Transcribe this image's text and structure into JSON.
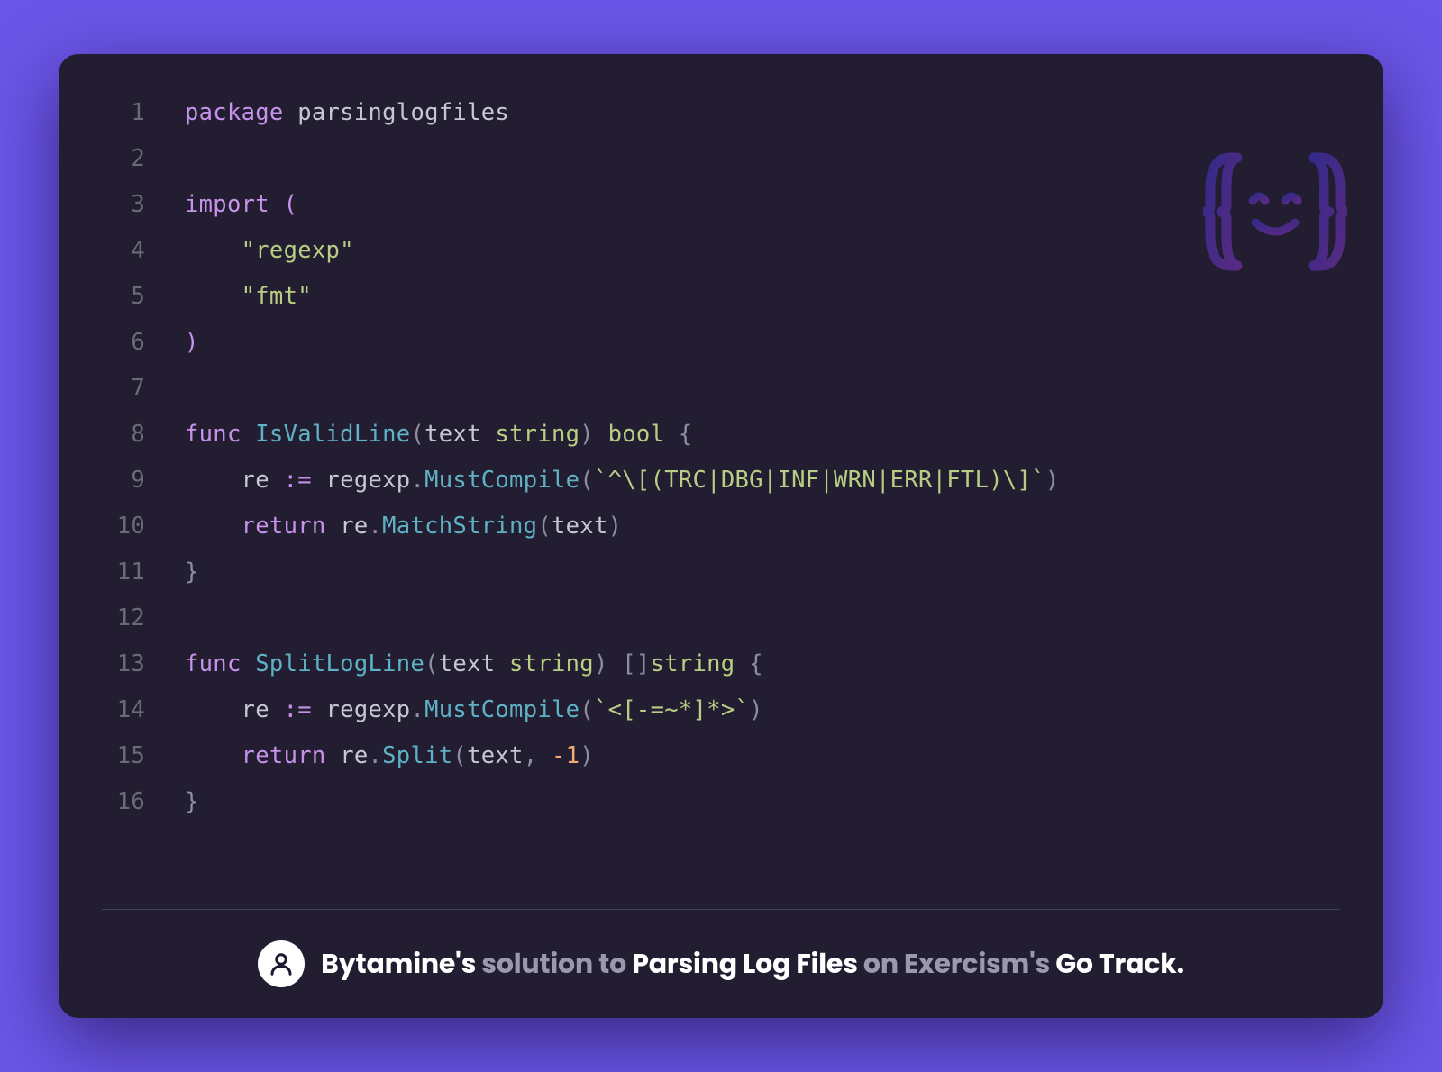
{
  "lineNumbers": [
    "1",
    "2",
    "3",
    "4",
    "5",
    "6",
    "7",
    "8",
    "9",
    "10",
    "11",
    "12",
    "13",
    "14",
    "15",
    "16"
  ],
  "code": {
    "l1": {
      "kw": "package",
      "pkg": " parsinglogfiles"
    },
    "l3": {
      "kw": "import",
      "sp": " ",
      "p": "("
    },
    "l4": {
      "indent": "    ",
      "str": "\"regexp\""
    },
    "l5": {
      "indent": "    ",
      "str": "\"fmt\""
    },
    "l6": {
      "p": ")"
    },
    "l8": {
      "kw": "func",
      "sp": " ",
      "fn": "IsValidLine",
      "po": "(",
      "arg": "text ",
      "typ": "string",
      "pc": ") ",
      "ret": "bool",
      "sp2": " ",
      "brace": "{"
    },
    "l9": {
      "indent": "    ",
      "var": "re ",
      "op": ":= ",
      "obj": "regexp",
      "dot": ".",
      "m": "MustCompile",
      "po": "(",
      "str": "`^\\[(TRC|DBG|INF|WRN|ERR|FTL)\\]`",
      "pc": ")"
    },
    "l10": {
      "indent": "    ",
      "kw": "return",
      "sp": " ",
      "obj": "re",
      "dot": ".",
      "m": "MatchString",
      "po": "(",
      "arg": "text",
      "pc": ")"
    },
    "l11": {
      "brace": "}"
    },
    "l13": {
      "kw": "func",
      "sp": " ",
      "fn": "SplitLogLine",
      "po": "(",
      "arg": "text ",
      "typ": "string",
      "pc": ") []",
      "ret": "string",
      "sp2": " ",
      "brace": "{"
    },
    "l14": {
      "indent": "    ",
      "var": "re ",
      "op": ":= ",
      "obj": "regexp",
      "dot": ".",
      "m": "MustCompile",
      "po": "(",
      "str": "`<[-=~*]*>`",
      "pc": ")"
    },
    "l15": {
      "indent": "    ",
      "kw": "return",
      "sp": " ",
      "obj": "re",
      "dot": ".",
      "m": "Split",
      "po": "(",
      "arg": "text",
      "comma": ", ",
      "num": "-1",
      "pc": ")"
    },
    "l16": {
      "brace": "}"
    }
  },
  "footer": {
    "user": "Bytamine's",
    "solution": " solution to ",
    "topic": "Parsing Log Files",
    "on": " on Exercism's ",
    "track": "Go Track."
  }
}
